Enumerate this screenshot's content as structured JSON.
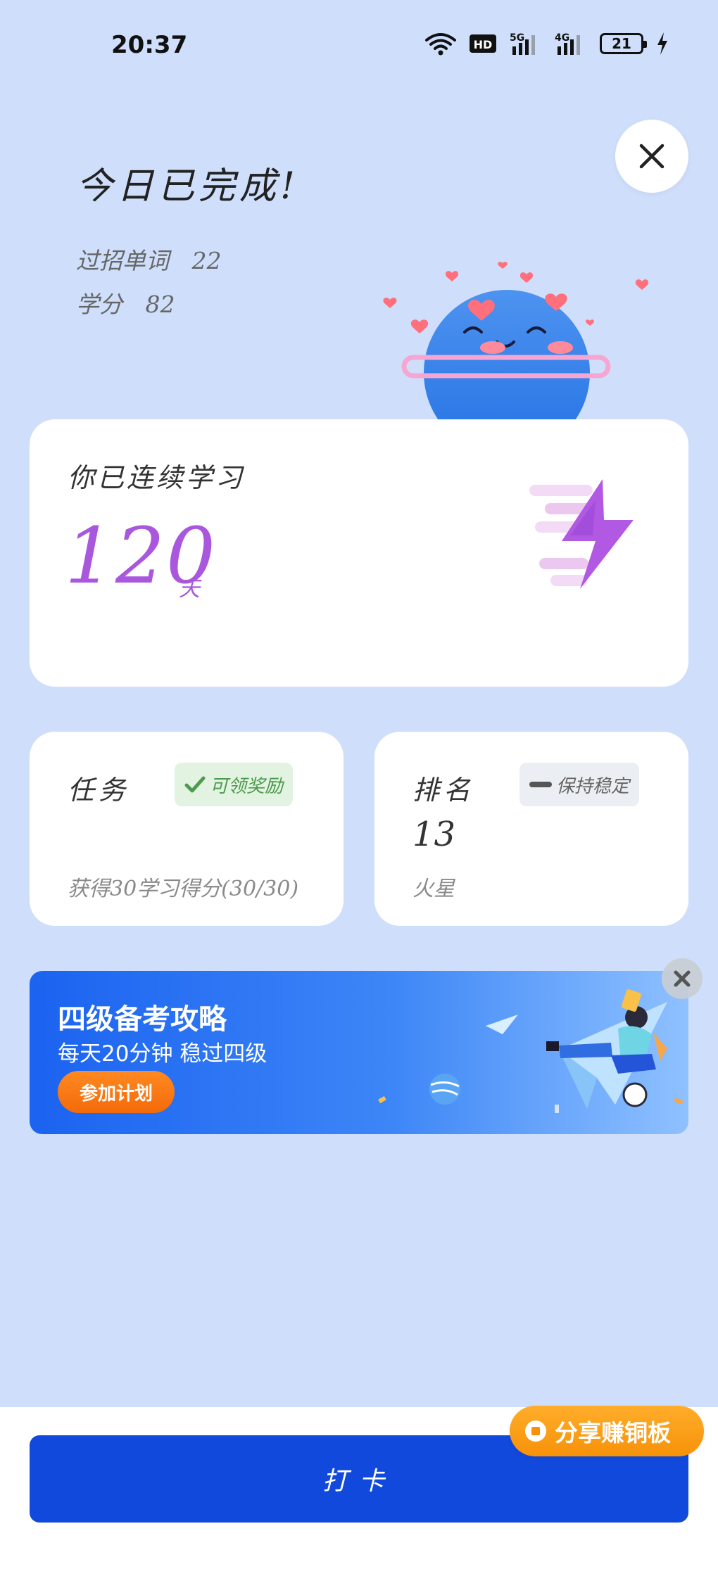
{
  "status_bar": {
    "time": "20:37",
    "battery": "21",
    "network_1": "5G",
    "network_2": "4G",
    "hd_label": "HD"
  },
  "hero": {
    "title": "今日已完成!",
    "stats": [
      {
        "label": "过招单词",
        "value": "22"
      },
      {
        "label": "学分",
        "value": "82"
      }
    ]
  },
  "streak": {
    "label": "你已连续学习",
    "days": "120",
    "unit": "天",
    "accent_color": "#a957dd"
  },
  "task_card": {
    "title": "任务",
    "badge": "可领奖励",
    "footer": "获得30学习得分(30/30)"
  },
  "rank_card": {
    "title": "排名",
    "badge": "保持稳定",
    "rank": "13",
    "footer": "火星"
  },
  "ad": {
    "title": "四级备考攻略",
    "subtitle": "每天20分钟 稳过四级",
    "button": "参加计划"
  },
  "bottom": {
    "checkin_label": "打卡",
    "share_label": "分享赚铜板",
    "primary_color": "#1249dd"
  }
}
